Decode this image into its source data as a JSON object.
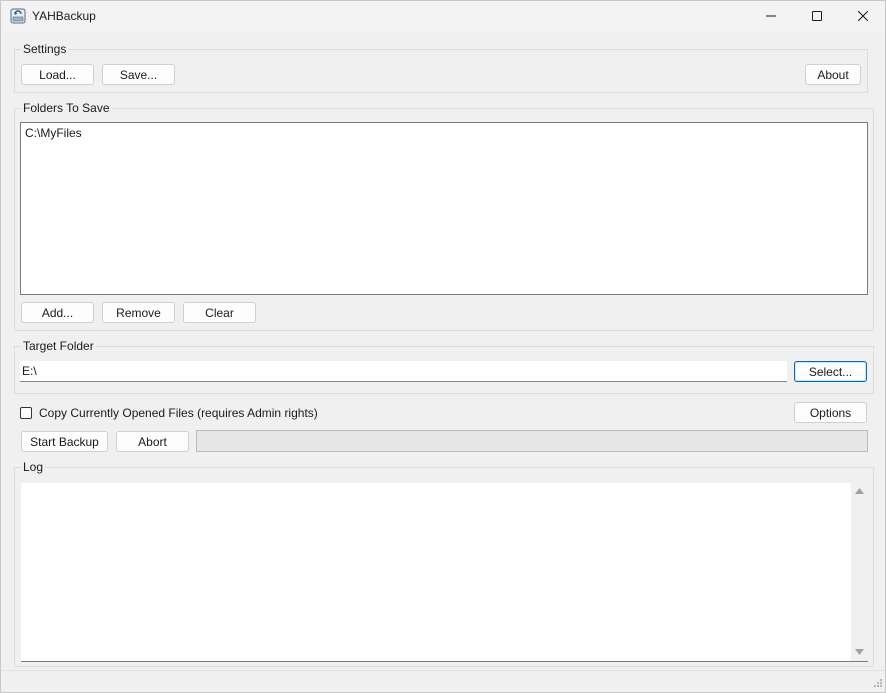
{
  "window": {
    "title": "YAHBackup",
    "icon": "backup-app-icon"
  },
  "settings": {
    "group_label": "Settings",
    "load_label": "Load...",
    "save_label": "Save...",
    "about_label": "About"
  },
  "folders": {
    "group_label": "Folders To Save",
    "items": [
      "C:\\MyFiles"
    ],
    "add_label": "Add...",
    "remove_label": "Remove",
    "clear_label": "Clear"
  },
  "target": {
    "group_label": "Target Folder",
    "value": "E:\\",
    "select_label": "Select..."
  },
  "options": {
    "copy_open_files_label": "Copy Currently Opened Files (requires Admin rights)",
    "copy_open_files_checked": false,
    "options_label": "Options"
  },
  "actions": {
    "start_label": "Start Backup",
    "abort_label": "Abort",
    "progress": 0
  },
  "log": {
    "group_label": "Log",
    "content": ""
  },
  "colors": {
    "accent": "#0067c0",
    "background": "#f0f0f0"
  }
}
